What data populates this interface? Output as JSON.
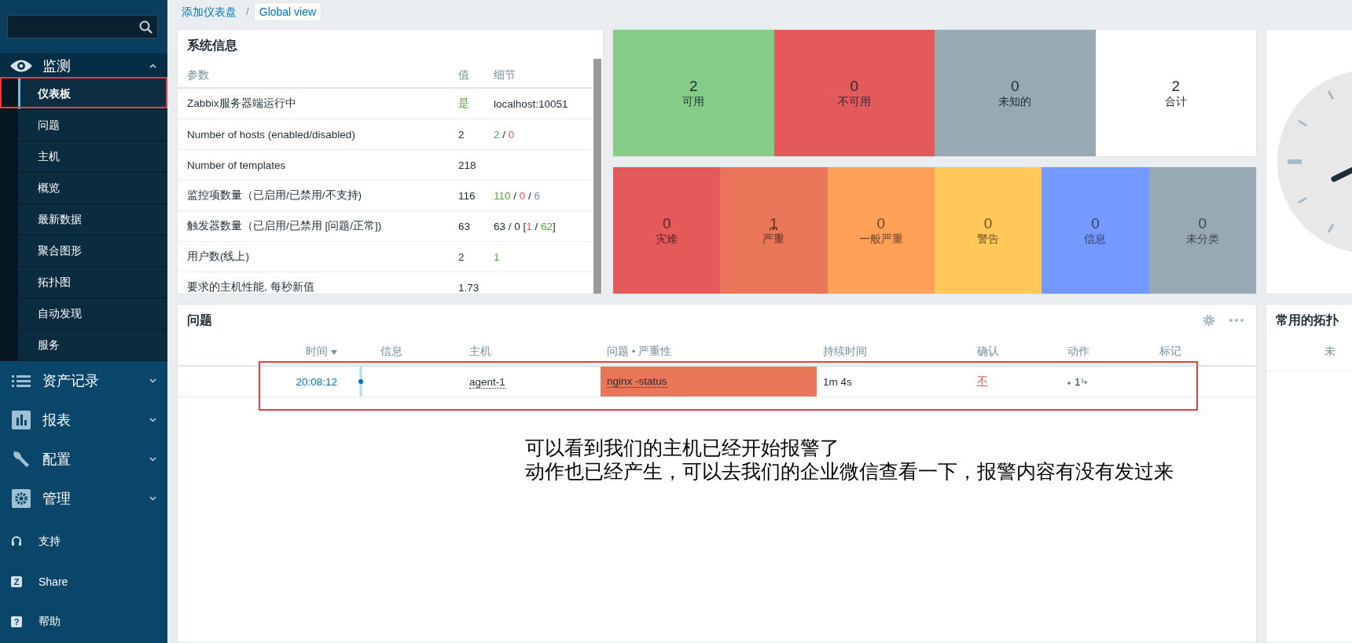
{
  "sidebar": {
    "menu": [
      {
        "label": "监测",
        "expanded": true,
        "children": [
          {
            "label": "仪表板",
            "selected": true,
            "annotated": true
          },
          {
            "label": "问题",
            "selected": false,
            "annotated": false
          },
          {
            "label": "主机",
            "selected": false,
            "annotated": false
          },
          {
            "label": "概览",
            "selected": false,
            "annotated": false
          },
          {
            "label": "最新数据",
            "selected": false,
            "annotated": false
          },
          {
            "label": "聚合图形",
            "selected": false,
            "annotated": false
          },
          {
            "label": "拓扑图",
            "selected": false,
            "annotated": false
          },
          {
            "label": "自动发现",
            "selected": false,
            "annotated": false
          },
          {
            "label": "服务",
            "selected": false,
            "annotated": false
          }
        ]
      },
      {
        "label": "资产记录",
        "expanded": false
      },
      {
        "label": "报表",
        "expanded": false
      },
      {
        "label": "配置",
        "expanded": false
      },
      {
        "label": "管理",
        "expanded": false
      }
    ],
    "footer": [
      {
        "label": "支持"
      },
      {
        "label": "Share",
        "badge": "Z"
      },
      {
        "label": "帮助",
        "badge": "?"
      }
    ]
  },
  "breadcrumb_separator": "/",
  "breadcrumb": [
    {
      "label": "添加仪表盘",
      "selected": false
    },
    {
      "label": "Global view",
      "selected": true
    }
  ],
  "system_info": {
    "title": "系统信息",
    "columns": [
      "参数",
      "值",
      "细节"
    ],
    "rows": [
      {
        "parameter": "Zabbix服务器端运行中",
        "value": [
          {
            "text": "是",
            "color": "#59a83a"
          }
        ],
        "details": [
          {
            "text": "localhost:10051"
          }
        ]
      },
      {
        "parameter": "Number of hosts (enabled/disabled)",
        "value": [
          {
            "text": "2",
            "color": "#1f2c33"
          }
        ],
        "details": [
          {
            "text": "2",
            "color": "#59a83a"
          },
          {
            "text": " / "
          },
          {
            "text": "0",
            "color": "#e45959"
          }
        ]
      },
      {
        "parameter": "Number of templates",
        "value": [
          {
            "text": "218",
            "color": "#1f2c33"
          }
        ],
        "details": []
      },
      {
        "parameter": "监控项数量（已启用/已禁用/不支持)",
        "value": [
          {
            "text": "116",
            "color": "#1f2c33"
          }
        ],
        "details": [
          {
            "text": "110",
            "color": "#59a83a"
          },
          {
            "text": " / "
          },
          {
            "text": "0",
            "color": "#e45959"
          },
          {
            "text": " / "
          },
          {
            "text": "6",
            "color": "#768d99"
          }
        ]
      },
      {
        "parameter": "触发器数量（已启用/已禁用 [问题/正常])",
        "value": [
          {
            "text": "63",
            "color": "#1f2c33"
          }
        ],
        "details": [
          {
            "text": "63 / 0 ["
          },
          {
            "text": "1",
            "color": "#e45959"
          },
          {
            "text": " / "
          },
          {
            "text": "62",
            "color": "#59a83a"
          },
          {
            "text": "]"
          }
        ]
      },
      {
        "parameter": "用户数(线上)",
        "value": [
          {
            "text": "2",
            "color": "#1f2c33"
          }
        ],
        "details": [
          {
            "text": "1",
            "color": "#59a83a"
          }
        ]
      },
      {
        "parameter": "要求的主机性能, 每秒新值",
        "value": [
          {
            "text": "1.73",
            "color": "#1f2c33"
          }
        ],
        "details": []
      }
    ]
  },
  "host_availability": [
    {
      "count": "2",
      "label": "可用",
      "color": "#86cc89"
    },
    {
      "count": "0",
      "label": "不可用",
      "color": "#e45959"
    },
    {
      "count": "0",
      "label": "未知的",
      "color": "#97aab3"
    },
    {
      "count": "2",
      "label": "合计",
      "color": "#ffffff"
    }
  ],
  "problems_by_severity": [
    {
      "count": "0",
      "label": "灾难",
      "color": "#e45959",
      "linked": false
    },
    {
      "count": "1",
      "label": "严重",
      "color": "#e97659",
      "linked": true
    },
    {
      "count": "0",
      "label": "一般严重",
      "color": "#ffa059",
      "linked": false
    },
    {
      "count": "0",
      "label": "警告",
      "color": "#ffc859",
      "linked": false
    },
    {
      "count": "0",
      "label": "信息",
      "color": "#7499ff",
      "linked": false
    },
    {
      "count": "0",
      "label": "未分类",
      "color": "#97aab3",
      "linked": false
    }
  ],
  "problems": {
    "title": "问题",
    "columns": [
      {
        "label": "时间",
        "sorted": true
      },
      {
        "label": "信息",
        "sorted": false
      },
      {
        "label": "主机",
        "sorted": false
      },
      {
        "label": "问题 • 严重性",
        "sorted": false
      },
      {
        "label": "持续时间",
        "sorted": false
      },
      {
        "label": "确认",
        "sorted": false
      },
      {
        "label": "动作",
        "sorted": false
      },
      {
        "label": "标记",
        "sorted": false
      }
    ],
    "rows": [
      {
        "time": "20:08:12",
        "host": "agent-1",
        "problem": "nginx -status",
        "color": "#e97659",
        "duration": "1m 4s",
        "ack": "不",
        "actions": "1",
        "annotated": true
      }
    ]
  },
  "favorite_maps": {
    "title": "常用的拓扑",
    "message": "未"
  },
  "caption": [
    "可以看到我们的主机已经开始报警了",
    "动作也已经产生，可以去我们的企业微信查看一下，报警内容有没有发过来"
  ]
}
